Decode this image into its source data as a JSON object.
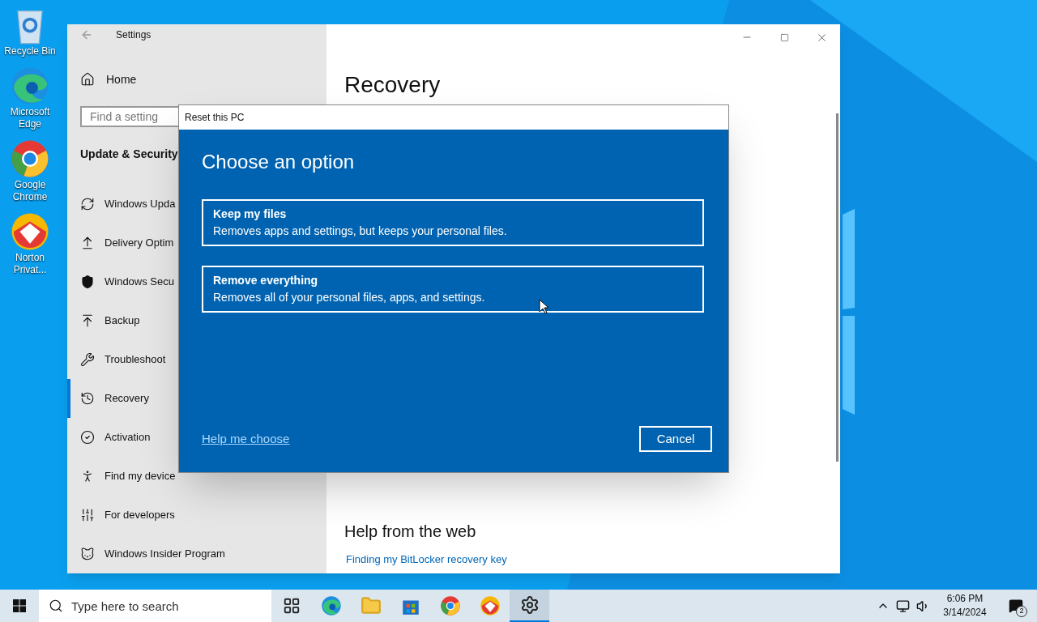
{
  "desktop_icons": [
    {
      "kind": "recycle",
      "label": "Recycle Bin"
    },
    {
      "kind": "edge",
      "label": "Microsoft Edge"
    },
    {
      "kind": "chrome",
      "label": "Google Chrome"
    },
    {
      "kind": "norton",
      "label": "Norton Privat..."
    }
  ],
  "settings_window": {
    "title": "Settings",
    "home": "Home",
    "search": {
      "placeholder": "Find a setting"
    },
    "section": "Update & Security",
    "sidebar": {
      "items": [
        {
          "kind": "update",
          "label": "Windows Upda",
          "selected": false
        },
        {
          "kind": "delivery",
          "label": "Delivery Optim",
          "selected": false
        },
        {
          "kind": "shield",
          "label": "Windows Secu",
          "selected": false
        },
        {
          "kind": "backup",
          "label": "Backup",
          "selected": false
        },
        {
          "kind": "wrench",
          "label": "Troubleshoot",
          "selected": false
        },
        {
          "kind": "recovery",
          "label": "Recovery",
          "selected": true
        },
        {
          "kind": "check",
          "label": "Activation",
          "selected": false
        },
        {
          "kind": "person",
          "label": "Find my device",
          "selected": false
        },
        {
          "kind": "tools",
          "label": "For developers",
          "selected": false
        },
        {
          "kind": "cat",
          "label": "Windows Insider Program",
          "selected": false
        }
      ]
    },
    "page_title": "Recovery",
    "help_heading": "Help from the web",
    "help_link": "Finding my BitLocker recovery key"
  },
  "dialog": {
    "title": "Reset this PC",
    "heading": "Choose an option",
    "options": [
      {
        "title": "Keep my files",
        "description": "Removes apps and settings, but keeps your personal files."
      },
      {
        "title": "Remove everything",
        "description": "Removes all of your personal files, apps, and settings."
      }
    ],
    "help_link": "Help me choose",
    "cancel": "Cancel"
  },
  "taskbar": {
    "search": {
      "placeholder": "Type here to search"
    },
    "apps": [
      {
        "kind": "taskview",
        "selected": false
      },
      {
        "kind": "edge",
        "selected": false
      },
      {
        "kind": "folder",
        "selected": false
      },
      {
        "kind": "store",
        "selected": false
      },
      {
        "kind": "chrome",
        "selected": false
      },
      {
        "kind": "norton",
        "selected": false
      },
      {
        "kind": "settings",
        "selected": true
      }
    ],
    "time": "6:06 PM",
    "date": "3/14/2024",
    "notifications": "2"
  }
}
